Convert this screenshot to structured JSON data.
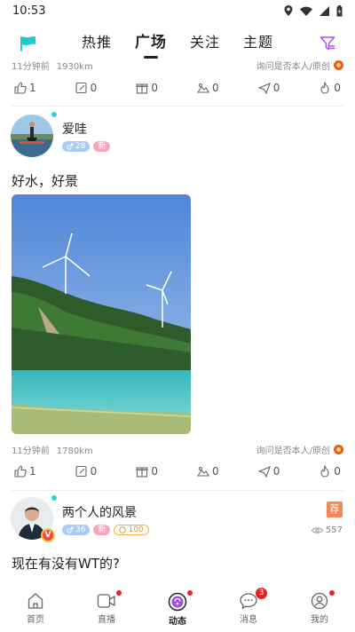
{
  "status_bar": {
    "time": "10:53"
  },
  "top_nav": {
    "tabs": [
      {
        "label": "热推",
        "active": false
      },
      {
        "label": "广场",
        "active": true
      },
      {
        "label": "关注",
        "active": false
      },
      {
        "label": "主题",
        "active": false
      }
    ]
  },
  "prev_post": {
    "time_ago": "11分钟前",
    "distance": "1930km",
    "origin_question": "询问是否本人/原创",
    "actions": [
      "1",
      "0",
      "0",
      "0",
      "0",
      "0"
    ]
  },
  "post1": {
    "username": "爱哇",
    "level": "28",
    "tag": "新",
    "text": "好水，好景",
    "time_ago": "11分钟前",
    "distance": "1780km",
    "origin_question": "询问是否本人/原创",
    "actions": [
      "1",
      "0",
      "0",
      "0",
      "0",
      "0"
    ]
  },
  "post2": {
    "username": "两个人的风景",
    "level": "36",
    "tag": "新",
    "points": "100",
    "vip_label": "V",
    "recommend_label": "荐",
    "views": "557",
    "text": "现在有没有WT的?"
  },
  "action_icons": [
    "thumbs-up-icon",
    "edit-icon",
    "gift-icon",
    "landscape-icon",
    "share-icon",
    "flame-icon"
  ],
  "bottom_nav": {
    "items": [
      {
        "label": "首页",
        "icon": "home-icon",
        "dot": false
      },
      {
        "label": "直播",
        "icon": "video-camera-icon",
        "dot": true
      },
      {
        "label": "动态",
        "icon": "moments-icon",
        "dot": true,
        "active": true
      },
      {
        "label": "消息",
        "icon": "chat-bubble-icon",
        "count": "3"
      },
      {
        "label": "我的",
        "icon": "profile-icon",
        "dot": true
      }
    ]
  },
  "colors": {
    "accent_teal": "#2ed3d0",
    "accent_purple": "#b14cf0",
    "badge_red": "#e52323",
    "recommend_orange": "#f5875a"
  }
}
